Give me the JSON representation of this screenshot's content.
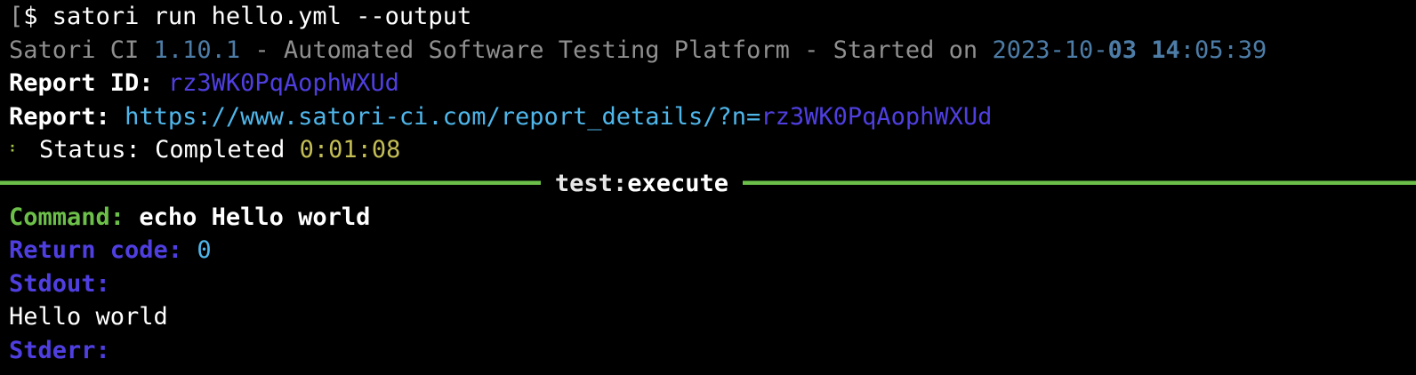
{
  "command_line": {
    "prompt": "$",
    "command": "satori run hello.yml --output"
  },
  "banner": {
    "product": "Satori CI",
    "version": "1.10.1",
    "tagline": "- Automated Software Testing Platform - Started on",
    "date_prefix": "2023-10-",
    "date_day": "03",
    "time_hour": "14",
    "time_rest": ":05:39"
  },
  "report_id": {
    "label": "Report ID:",
    "value": "rz3WK0PqAophWXUd"
  },
  "report_url": {
    "label": "Report:",
    "url_base": "https://www.satori-ci.com/report_details/?n=",
    "url_id": "rz3WK0PqAophWXUd"
  },
  "status": {
    "spinner": "⠃",
    "label": "Status:",
    "value": "Completed",
    "elapsed": "0:01:08"
  },
  "section": {
    "category": "test",
    "separator": ":",
    "action": "execute"
  },
  "result": {
    "command_label": "Command:",
    "command_value": "echo Hello world",
    "return_code_label": "Return code:",
    "return_code_value": "0",
    "stdout_label": "Stdout:",
    "stdout_value": "Hello world",
    "stderr_label": "Stderr:"
  },
  "colors": {
    "background": "#000000",
    "gray_text": "#8f8f8f",
    "version_blue": "#4d7ca6",
    "purple_accent": "#4f3fe0",
    "cyan_url": "#4fb6ea",
    "olive_elapsed": "#c2bd55",
    "green_rule": "#6cc04a"
  }
}
